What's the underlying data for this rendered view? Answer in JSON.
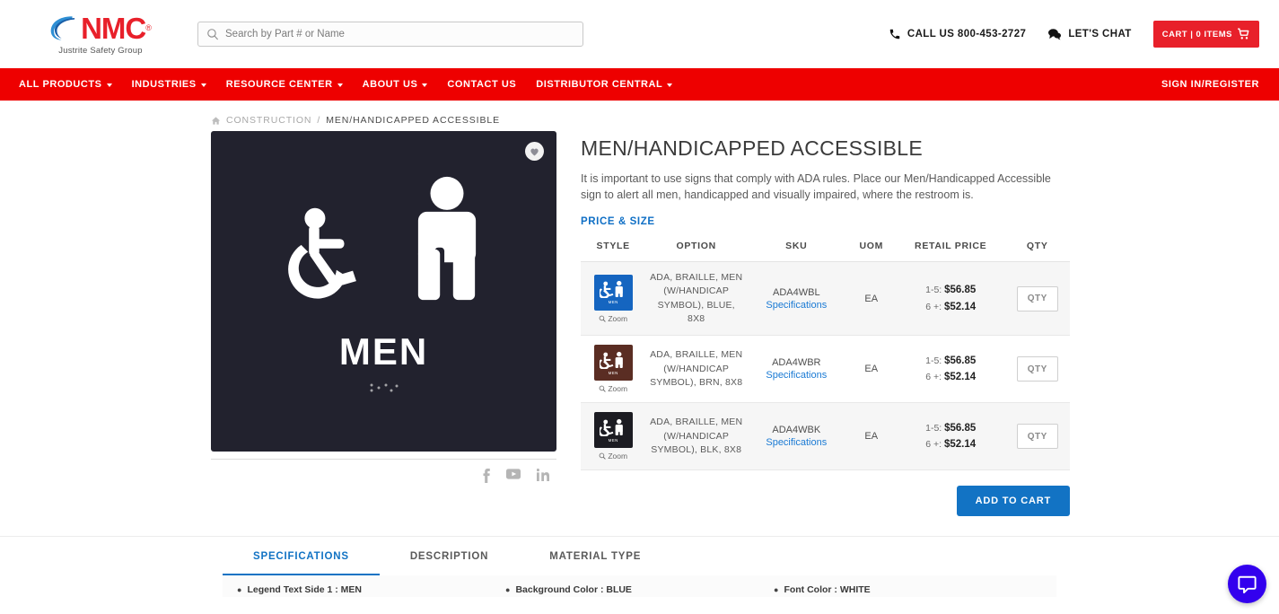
{
  "header": {
    "logo_name": "NMC",
    "logo_tagline": "Justrite Safety Group",
    "search_placeholder": "Search by Part # or Name",
    "search_value": "",
    "call_label": "CALL US 800-453-2727",
    "chat_label": "LET'S CHAT",
    "cart_label": "CART | 0 ITEMS"
  },
  "nav": {
    "items": [
      {
        "label": "ALL PRODUCTS",
        "caret": true
      },
      {
        "label": "INDUSTRIES",
        "caret": true
      },
      {
        "label": "RESOURCE CENTER",
        "caret": true
      },
      {
        "label": "ABOUT US",
        "caret": true
      },
      {
        "label": "CONTACT US",
        "caret": false
      },
      {
        "label": "DISTRIBUTOR CENTRAL",
        "caret": true
      }
    ],
    "signin_label": "SIGN IN/REGISTER"
  },
  "breadcrumb": {
    "home_icon": "home-icon",
    "category": "CONSTRUCTION",
    "separator": "/",
    "current": "MEN/HANDICAPPED ACCESSIBLE"
  },
  "product": {
    "title": "MEN/HANDICAPPED ACCESSIBLE",
    "description": "It is important to use signs that comply with ADA rules. Place our Men/Handicapped Accessible sign to alert all men, handicapped and visually impaired, where the restroom is.",
    "price_size_label": "PRICE & SIZE",
    "image": {
      "sign_text": "MEN",
      "background_color": "#22222e",
      "wishlist_icon": "heart-icon"
    },
    "socials": [
      {
        "name": "facebook-icon"
      },
      {
        "name": "youtube-icon"
      },
      {
        "name": "linkedin-icon"
      }
    ]
  },
  "table": {
    "headers": [
      "STYLE",
      "OPTION",
      "SKU",
      "UOM",
      "RETAIL PRICE",
      "QTY"
    ],
    "zoom_label": "Zoom",
    "spec_link_label": "Specifications",
    "qty_placeholder": "QTY",
    "rows": [
      {
        "swatch_color": "#1565c0",
        "swatch_caption": "MEN",
        "option": "ADA, BRAILLE, MEN (W/HANDICAP SYMBOL), BLUE, 8X8",
        "sku": "ADA4WBL",
        "uom": "EA",
        "price_tier_1": "1-5:",
        "price_1": "$56.85",
        "price_tier_2": "6 +:",
        "price_2": "$52.14",
        "qty_value": ""
      },
      {
        "swatch_color": "#5a2d23",
        "swatch_caption": "MEN",
        "option": "ADA, BRAILLE, MEN (W/HANDICAP SYMBOL), BRN, 8X8",
        "sku": "ADA4WBR",
        "uom": "EA",
        "price_tier_1": "1-5:",
        "price_1": "$56.85",
        "price_tier_2": "6 +:",
        "price_2": "$52.14",
        "qty_value": ""
      },
      {
        "swatch_color": "#1c1c22",
        "swatch_caption": "MEN",
        "option": "ADA, BRAILLE, MEN (W/HANDICAP SYMBOL), BLK, 8X8",
        "sku": "ADA4WBK",
        "uom": "EA",
        "price_tier_1": "1-5:",
        "price_1": "$56.85",
        "price_tier_2": "6 +:",
        "price_2": "$52.14",
        "qty_value": ""
      }
    ]
  },
  "actions": {
    "add_to_cart_label": "ADD TO CART"
  },
  "tabs": [
    {
      "label": "SPECIFICATIONS",
      "active": true
    },
    {
      "label": "DESCRIPTION",
      "active": false
    },
    {
      "label": "MATERIAL TYPE",
      "active": false
    }
  ],
  "specs": [
    "Legend Text Side 1 : MEN",
    "Background Color : BLUE",
    "Font Color : WHITE"
  ],
  "chat_widget": {
    "icon": "chat-bubble-icon",
    "color": "#3300ee"
  },
  "colors": {
    "brand_red": "#ee0000",
    "logo_red": "#e8202a",
    "accent_blue": "#1273c4",
    "link_blue": "#1a7ad4",
    "price_label_blue": "#0f6fc5"
  }
}
